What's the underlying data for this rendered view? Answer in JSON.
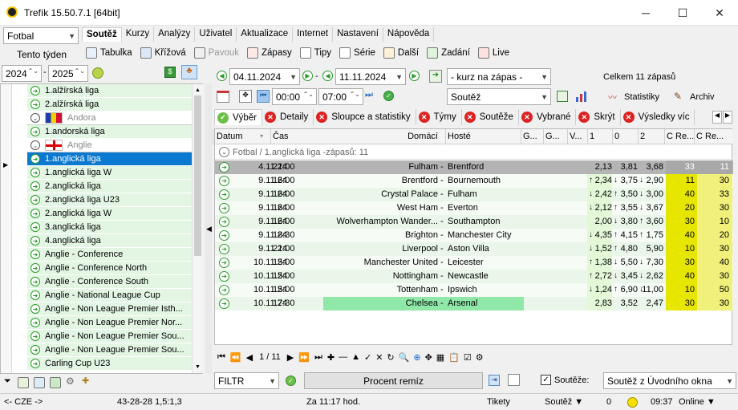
{
  "window": {
    "title": "Trefík 15.50.7.1 [64bit]",
    "min": "─",
    "max": "☐",
    "close": "✕"
  },
  "left": {
    "sport": "Fotbal",
    "week_button": "Tento týden",
    "year_from": "2024",
    "year_to": "2025",
    "dash": "-"
  },
  "menu": [
    "Soutěž",
    "Kurzy",
    "Analýzy",
    "Uživatel",
    "Aktualizace",
    "Internet",
    "Nastavení",
    "Nápověda"
  ],
  "toolbar": [
    "Tabulka",
    "Křížová",
    "Pavouk",
    "Zápasy",
    "Tipy",
    "Série",
    "Další",
    "Zadání",
    "Live"
  ],
  "leagues": [
    {
      "label": "1.alžírská liga",
      "style": "green"
    },
    {
      "label": "2.alžírská liga",
      "style": "green"
    },
    {
      "label": "Andora",
      "style": "country",
      "flag": "andorra"
    },
    {
      "label": "1.andorská liga",
      "style": "green"
    },
    {
      "label": "Anglie",
      "style": "country",
      "flag": "england"
    },
    {
      "label": "1.anglická liga",
      "style": "selected"
    },
    {
      "label": "1.anglická liga W",
      "style": "green"
    },
    {
      "label": "2.anglická liga",
      "style": "green"
    },
    {
      "label": "2.anglická liga U23",
      "style": "green"
    },
    {
      "label": "2.anglická liga W",
      "style": "green"
    },
    {
      "label": "3.anglická liga",
      "style": "green"
    },
    {
      "label": "4.anglická liga",
      "style": "green"
    },
    {
      "label": "Anglie - Conference",
      "style": "green"
    },
    {
      "label": "Anglie - Conference North",
      "style": "green"
    },
    {
      "label": "Anglie - Conference South",
      "style": "green"
    },
    {
      "label": "Anglie - National League Cup",
      "style": "green"
    },
    {
      "label": "Anglie - Non League Premier Isth...",
      "style": "green"
    },
    {
      "label": "Anglie - Non League Premier Nor...",
      "style": "green"
    },
    {
      "label": "Anglie - Non League Premier Sou...",
      "style": "green"
    },
    {
      "label": "Anglie - Non League Premier Sou...",
      "style": "green"
    },
    {
      "label": "Carling Cup U23",
      "style": "green"
    }
  ],
  "filters": {
    "date_from": "04.11.2024",
    "date_to": "11.11.2024",
    "odds_mode": "- kurz na zápas -",
    "total": "Celkem 11 zápasů",
    "time_from": "00:00",
    "time_to": "07:00",
    "competition_mode": "Soutěž",
    "stats": "Statistiky",
    "archive": "Archiv"
  },
  "tabs": [
    "Výběr",
    "Detaily",
    "Sloupce a statistiky",
    "Týmy",
    "Soutěže",
    "Vybrané",
    "Skrýt",
    "Výsledky víc"
  ],
  "grid": {
    "headers": [
      "Datum",
      "Čas",
      "Domácí",
      "Hosté",
      "G...",
      "G...",
      "V...",
      "1",
      "0",
      "2",
      "C Re...",
      "C Re..."
    ],
    "group": "Fotbal / 1.anglická liga -zápasů: 11",
    "rows": [
      {
        "date": "4.11.24",
        "time": "21:00",
        "home": "Fulham",
        "away": "Brentford",
        "o1": "2,13",
        "o0": "3,81",
        "o2": "3,68",
        "c1": "33",
        "c2": "11",
        "a1": "",
        "a0": "",
        "a2": "",
        "hl": "gray"
      },
      {
        "date": "9.11.24",
        "time": "16:00",
        "home": "Brentford",
        "away": "Bournemouth",
        "o1": "2,34",
        "o0": "3,75",
        "o2": "2,90",
        "c1": "11",
        "c2": "30",
        "a1": "↑",
        "a0": "↓",
        "a2": "↓",
        "hl": ""
      },
      {
        "date": "9.11.24",
        "time": "16:00",
        "home": "Crystal Palace",
        "away": "Fulham",
        "o1": "2,42",
        "o0": "3,50",
        "o2": "3,00",
        "c1": "40",
        "c2": "33",
        "a1": "↓",
        "a0": "↑",
        "a2": "↓",
        "hl": ""
      },
      {
        "date": "9.11.24",
        "time": "16:00",
        "home": "West Ham",
        "away": "Everton",
        "o1": "2,12",
        "o0": "3,55",
        "o2": "3,67",
        "c1": "20",
        "c2": "30",
        "a1": "↓",
        "a0": "↑",
        "a2": "↓",
        "hl": ""
      },
      {
        "date": "9.11.24",
        "time": "16:00",
        "home": "Wolverhampton Wander...",
        "away": "Southampton",
        "o1": "2,00",
        "o0": "3,80",
        "o2": "3,60",
        "c1": "30",
        "c2": "10",
        "a1": "",
        "a0": "↓",
        "a2": "↑",
        "hl": ""
      },
      {
        "date": "9.11.24",
        "time": "18:30",
        "home": "Brighton",
        "away": "Manchester City",
        "o1": "4,35",
        "o0": "4,15",
        "o2": "1,75",
        "c1": "40",
        "c2": "20",
        "a1": "↓",
        "a0": "↑",
        "a2": "↑",
        "hl": ""
      },
      {
        "date": "9.11.24",
        "time": "21:00",
        "home": "Liverpool",
        "away": "Aston Villa",
        "o1": "1,52",
        "o0": "4,80",
        "o2": "5,90",
        "c1": "10",
        "c2": "30",
        "a1": "↓",
        "a0": "↑",
        "a2": "",
        "hl": ""
      },
      {
        "date": "10.11.24",
        "time": "15:00",
        "home": "Manchester United",
        "away": "Leicester",
        "o1": "1,38",
        "o0": "5,50",
        "o2": "7,30",
        "c1": "30",
        "c2": "40",
        "a1": "↑",
        "a0": "↓",
        "a2": "↓",
        "hl": ""
      },
      {
        "date": "10.11.24",
        "time": "15:00",
        "home": "Nottingham",
        "away": "Newcastle",
        "o1": "2,72",
        "o0": "3,45",
        "o2": "2,62",
        "c1": "40",
        "c2": "30",
        "a1": "↑",
        "a0": "↓",
        "a2": "↓",
        "hl": ""
      },
      {
        "date": "10.11.24",
        "time": "15:00",
        "home": "Tottenham",
        "away": "Ipswich",
        "o1": "1,24",
        "o0": "6,90",
        "o2": "11,00",
        "c1": "10",
        "c2": "50",
        "a1": "↓",
        "a0": "↑",
        "a2": "↓",
        "hl": ""
      },
      {
        "date": "10.11.24",
        "time": "17:30",
        "home": "Chelsea",
        "away": "Arsenal",
        "o1": "2,83",
        "o0": "3,52",
        "o2": "2,47",
        "c1": "30",
        "c2": "30",
        "a1": "",
        "a0": "",
        "a2": "",
        "hl": "teams"
      }
    ]
  },
  "pager": {
    "text": "1 / 11"
  },
  "bottom": {
    "filter": "FILTR",
    "remiz": "Procent remíz",
    "souteze": "Soutěže:",
    "combo": "Soutěž z Úvodního okna"
  },
  "status": {
    "country": "<- CZE ->",
    "stats": "43-28-28  1,5:1,3",
    "time": "Za 11:17 hod.",
    "tickets": "Tikety",
    "comp": "Soutěž ▼",
    "zero": "0",
    "clock": "09:37",
    "online": "Online ▼"
  }
}
